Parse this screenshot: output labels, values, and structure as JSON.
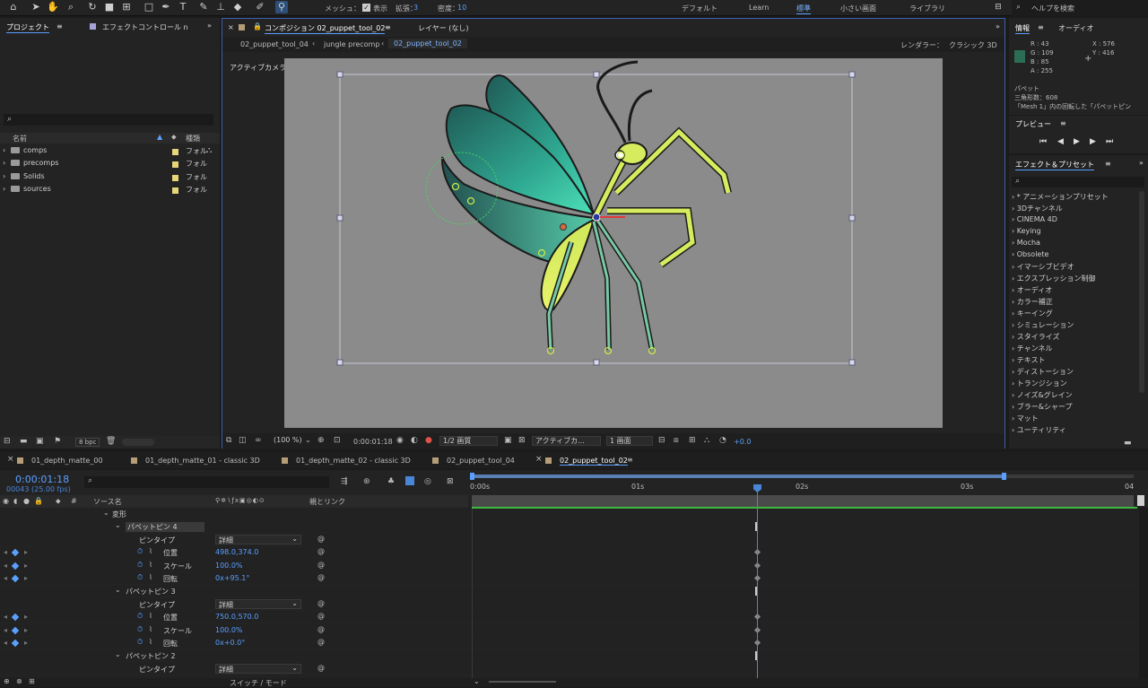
{
  "toolbar": {
    "mesh_label": "メッシュ：",
    "show_label": "表示",
    "expand_label": "拡張：",
    "expand_value": "3",
    "density_label": "密度：",
    "density_value": "10"
  },
  "workspaces": [
    "デフォルト",
    "Learn",
    "標準",
    "小さい画面",
    "ライブラリ"
  ],
  "search_help": "ヘルプを検索",
  "project": {
    "tab": "プロジェクト",
    "effects_tab": "エフェクトコントロール n",
    "col_name": "名前",
    "col_type": "種類",
    "items": [
      {
        "name": "comps",
        "type": "フォル"
      },
      {
        "name": "precomps",
        "type": "フォル"
      },
      {
        "name": "Solids",
        "type": "フォル"
      },
      {
        "name": "sources",
        "type": "フォル"
      }
    ],
    "bpc": "8 bpc"
  },
  "comp": {
    "tab": "コンポジション 02_puppet_tool_02",
    "layer_tab": "レイヤー (なし)",
    "breadcrumbs": [
      "02_puppet_tool_04",
      "jungle precomp",
      "02_puppet_tool_02"
    ],
    "renderer_label": "レンダラー：",
    "renderer_value": "クラシック 3D",
    "camera_label": "アクティブカメラ",
    "zoom": "(100 %)",
    "timecode": "0:00:01:18",
    "resolution": "1/2 画質",
    "camera_select": "アクティブカ...",
    "view_select": "1 画面",
    "exposure": "+0.0"
  },
  "info": {
    "tab": "情報",
    "audio_tab": "オーディオ",
    "R": "R : 43",
    "G": "G : 109",
    "B": "B : 85",
    "A": "A : 255",
    "X": "X : 576",
    "Y": "Y : 416",
    "puppet_label": "パペット",
    "triangles": "三角形数：608",
    "mesh_note": "「Mesh 1」内の回転した「パペットピン"
  },
  "preview": {
    "tab": "プレビュー"
  },
  "effects_presets": {
    "tab": "エフェクト＆プリセット",
    "items": [
      "* アニメーションプリセット",
      "3Dチャンネル",
      "CINEMA 4D",
      "Keying",
      "Mocha",
      "Obsolete",
      "イマーシブビデオ",
      "エクスプレッション制御",
      "オーディオ",
      "カラー補正",
      "キーイング",
      "シミュレーション",
      "スタイライズ",
      "チャンネル",
      "テキスト",
      "ディストーション",
      "トランジション",
      "ノイズ&グレイン",
      "ブラー&シャープ",
      "マット",
      "ユーティリティ"
    ]
  },
  "timeline": {
    "tabs": [
      "01_depth_matte_00",
      "01_depth_matte_01 - classic 3D",
      "01_depth_matte_02 - classic 3D",
      "02_puppet_tool_04",
      "02_puppet_tool_02"
    ],
    "timecode": "0:00:01:18",
    "frames": "00043 (25.00 fps)",
    "col_source": "ソース名",
    "col_parent": "親とリンク",
    "ruler": [
      "0:00s",
      "01s",
      "02s",
      "03s",
      "04"
    ],
    "rows": [
      {
        "indent": 0,
        "label": "変形",
        "value": ""
      },
      {
        "indent": 1,
        "label": "パペットピン 4",
        "value": ""
      },
      {
        "indent": 2,
        "label": "ピンタイプ",
        "value": "詳細",
        "kind": "select"
      },
      {
        "indent": 2,
        "label": "位置",
        "value": "498.0,374.0",
        "kind": "prop"
      },
      {
        "indent": 2,
        "label": "スケール",
        "value": "100.0%",
        "kind": "prop"
      },
      {
        "indent": 2,
        "label": "回転",
        "value": "0x+95.1°",
        "kind": "prop"
      },
      {
        "indent": 1,
        "label": "パペットピン 3",
        "value": ""
      },
      {
        "indent": 2,
        "label": "ピンタイプ",
        "value": "詳細",
        "kind": "select"
      },
      {
        "indent": 2,
        "label": "位置",
        "value": "750.0,570.0",
        "kind": "prop"
      },
      {
        "indent": 2,
        "label": "スケール",
        "value": "100.0%",
        "kind": "prop"
      },
      {
        "indent": 2,
        "label": "回転",
        "value": "0x+0.0°",
        "kind": "prop"
      },
      {
        "indent": 1,
        "label": "パペットピン 2",
        "value": ""
      },
      {
        "indent": 2,
        "label": "ピンタイプ",
        "value": "詳細",
        "kind": "select"
      }
    ],
    "switch_mode": "スイッチ / モード"
  },
  "colors": {
    "accent": "#5aa0ff",
    "swatch": "#2b6d55"
  }
}
